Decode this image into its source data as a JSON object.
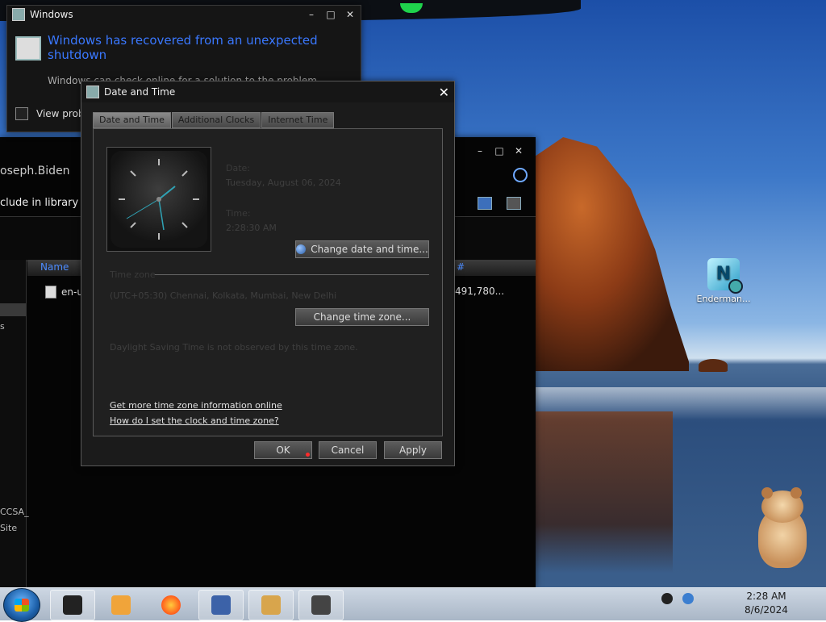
{
  "report_window": {
    "title": "Windows",
    "heading": "Windows has recovered from an unexpected shutdown",
    "subtext": "Windows can check online for a solution to the problem.",
    "view_label": "View probl"
  },
  "media_window": {
    "title_fragment": "oseph.Biden",
    "include_label": "clude in library",
    "column_name": "Name",
    "column_hash": "#",
    "row_name": "en-us",
    "row_size": "491,780...",
    "side_items": [
      "s",
      "CCSA_",
      "Site"
    ]
  },
  "dialog": {
    "title": "Date and Time",
    "tabs": [
      "Date and Time",
      "Additional Clocks",
      "Internet Time"
    ],
    "date_label": "Date:",
    "date_value": "Tuesday, August 06, 2024",
    "time_label": "Time:",
    "time_value": "2:28:30 AM",
    "change_datetime_button": "Change date and time...",
    "timezone_label": "Time zone",
    "timezone_value": "(UTC+05:30) Chennai, Kolkata, Mumbai, New Delhi",
    "change_timezone_button": "Change time zone...",
    "dst_note": "Daylight Saving Time is not observed by this time zone.",
    "link_more_info": "Get more time zone information online",
    "link_how_set": "How do I set the clock and time zone?",
    "ok_button": "OK",
    "cancel_button": "Cancel",
    "apply_button": "Apply"
  },
  "desktop": {
    "icon_label": "Enderman..."
  },
  "taskbar": {
    "time": "2:28 AM",
    "date": "8/6/2024"
  }
}
